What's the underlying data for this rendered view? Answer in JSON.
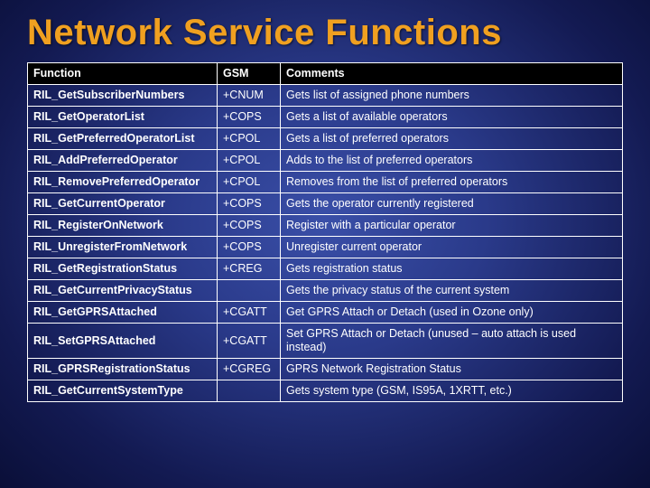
{
  "title": "Network Service Functions",
  "table": {
    "headers": {
      "function": "Function",
      "gsm": "GSM",
      "comments": "Comments"
    },
    "rows": [
      {
        "fn": "RIL_GetSubscriberNumbers",
        "gsm": "+CNUM",
        "comment": "Gets list of assigned phone numbers"
      },
      {
        "fn": "RIL_GetOperatorList",
        "gsm": "+COPS",
        "comment": "Gets a list of available operators"
      },
      {
        "fn": "RIL_GetPreferredOperatorList",
        "gsm": "+CPOL",
        "comment": "Gets a list of preferred operators"
      },
      {
        "fn": "RIL_AddPreferredOperator",
        "gsm": "+CPOL",
        "comment": "Adds to the list of preferred operators"
      },
      {
        "fn": "RIL_RemovePreferredOperator",
        "gsm": "+CPOL",
        "comment": "Removes from the list of preferred operators"
      },
      {
        "fn": "RIL_GetCurrentOperator",
        "gsm": "+COPS",
        "comment": "Gets the operator currently registered"
      },
      {
        "fn": "RIL_RegisterOnNetwork",
        "gsm": "+COPS",
        "comment": "Register with a particular operator"
      },
      {
        "fn": "RIL_UnregisterFromNetwork",
        "gsm": "+COPS",
        "comment": "Unregister current operator"
      },
      {
        "fn": "RIL_GetRegistrationStatus",
        "gsm": "+CREG",
        "comment": "Gets registration status"
      },
      {
        "fn": "RIL_GetCurrentPrivacyStatus",
        "gsm": "",
        "comment": "Gets the privacy status of the current system"
      },
      {
        "fn": "RIL_GetGPRSAttached",
        "gsm": "+CGATT",
        "comment": "Get GPRS Attach or Detach (used in Ozone only)"
      },
      {
        "fn": "RIL_SetGPRSAttached",
        "gsm": "+CGATT",
        "comment": "Set GPRS Attach or Detach (unused – auto attach is used instead)"
      },
      {
        "fn": "RIL_GPRSRegistrationStatus",
        "gsm": "+CGREG",
        "comment": "GPRS Network Registration Status"
      },
      {
        "fn": "RIL_GetCurrentSystemType",
        "gsm": "",
        "comment": "Gets system type (GSM, IS95A, 1XRTT, etc.)"
      }
    ]
  }
}
